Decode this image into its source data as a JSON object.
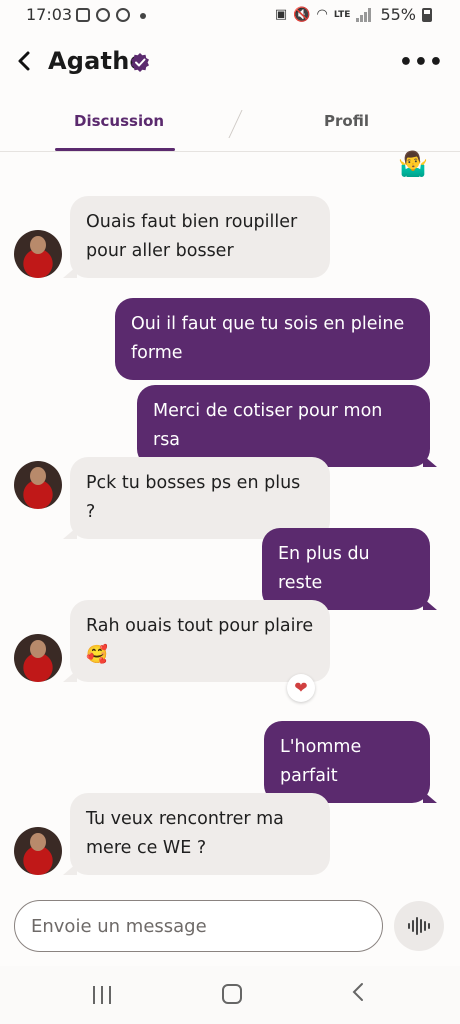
{
  "status": {
    "time": "17:03",
    "battery": "55%",
    "network": "LTE"
  },
  "header": {
    "back_icon": "chevron-left-icon",
    "title": "Agathe",
    "verified_icon": "verified-badge-icon",
    "more_icon": "more-dots-icon"
  },
  "tabs": [
    {
      "label": "Discussion",
      "active": true
    },
    {
      "label": "Profil",
      "active": false
    }
  ],
  "messages": [
    {
      "from": "them",
      "text": "Ouais faut bien roupiller pour aller bosser"
    },
    {
      "from": "me",
      "text": "Oui il faut que tu sois en pleine forme"
    },
    {
      "from": "me",
      "text": "Merci de cotiser pour mon rsa"
    },
    {
      "from": "them",
      "text": "Pck tu bosses ps en plus ?"
    },
    {
      "from": "me",
      "text": "En plus du reste"
    },
    {
      "from": "them",
      "text": "Rah ouais tout pour plaire",
      "emoji": "🥰",
      "reaction": "❤"
    },
    {
      "from": "me",
      "text": "L'homme parfait"
    },
    {
      "from": "them",
      "text": "Tu veux rencontrer ma mere ce WE ?"
    }
  ],
  "top_emoji": "🤷‍♂️",
  "composer": {
    "placeholder": "Envoie un message",
    "voice_icon": "voice-waveform-icon"
  },
  "colors": {
    "accent": "#5b2a6e",
    "incoming_bubble": "#efecea"
  }
}
